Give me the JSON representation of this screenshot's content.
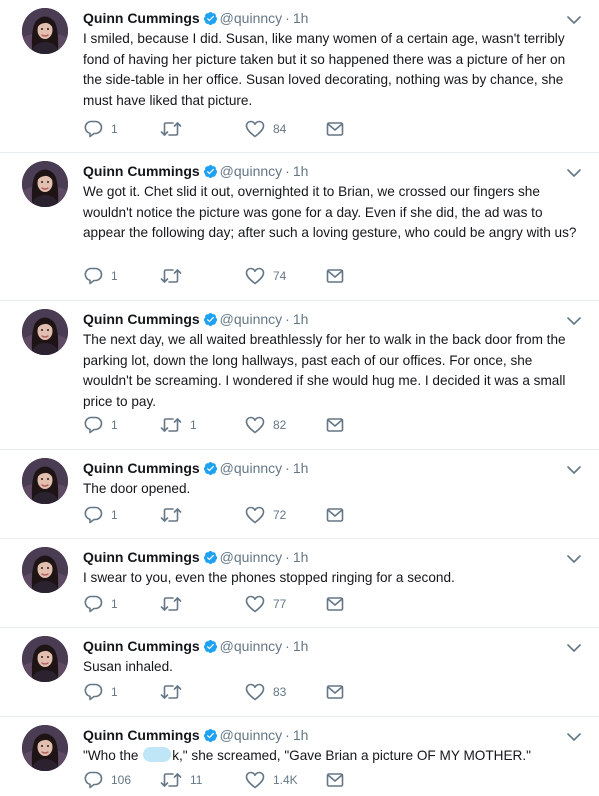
{
  "tweets": [
    {
      "author": "Quinn Cummings",
      "handle": "@quinncy",
      "separator": "·",
      "time": "1h",
      "text": "I smiled, because I did. Susan, like many women of a certain age, wasn't terribly fond of having her picture taken but it so happened there was a picture of her on the side-table in her office. Susan loved decorating, nothing was by chance, she must have liked that picture.",
      "replies": "1",
      "retweets": "",
      "likes": "84"
    },
    {
      "author": "Quinn Cummings",
      "handle": "@quinncy",
      "separator": "·",
      "time": "1h",
      "text": "We got it. Chet slid it out, overnighted it to Brian, we crossed our fingers she wouldn't notice the picture was gone for a day. Even if she did, the ad was to appear the following day; after such a loving gesture, who could be angry with us?",
      "replies": "1",
      "retweets": "",
      "likes": "74"
    },
    {
      "author": "Quinn Cummings",
      "handle": "@quinncy",
      "separator": "·",
      "time": "1h",
      "text": "The next day, we all waited breathlessly for her to walk in the back door from the parking lot, down the long hallways, past each of our offices. For once, she wouldn't be screaming. I wondered if she would hug me. I decided it was a small price to pay.",
      "replies": "1",
      "retweets": "1",
      "likes": "82"
    },
    {
      "author": "Quinn Cummings",
      "handle": "@quinncy",
      "separator": "·",
      "time": "1h",
      "text": "The door opened.",
      "replies": "1",
      "retweets": "",
      "likes": "72"
    },
    {
      "author": "Quinn Cummings",
      "handle": "@quinncy",
      "separator": "·",
      "time": "1h",
      "text": "I swear to you, even the phones stopped ringing for a second.",
      "replies": "1",
      "retweets": "",
      "likes": "77"
    },
    {
      "author": "Quinn Cummings",
      "handle": "@quinncy",
      "separator": "·",
      "time": "1h",
      "text": "Susan inhaled.",
      "replies": "1",
      "retweets": "",
      "likes": "83"
    },
    {
      "author": "Quinn Cummings",
      "handle": "@quinncy",
      "separator": "·",
      "time": "1h",
      "text_before": "\"Who the ",
      "text_after": "k,\" she screamed, \"Gave Brian a picture OF MY MOTHER.\"",
      "replies": "106",
      "retweets": "11",
      "likes": "1.4K"
    }
  ],
  "colors": {
    "text": "#14171a",
    "secondary": "#657786",
    "verified": "#1da1f2",
    "separator": "#e6ecf0",
    "blur": "#bfe6f7"
  },
  "icons": {
    "verified": "verified-badge-icon",
    "caret": "chevron-down-icon",
    "reply": "reply-icon",
    "retweet": "retweet-icon",
    "like": "heart-icon",
    "dm": "envelope-icon"
  }
}
